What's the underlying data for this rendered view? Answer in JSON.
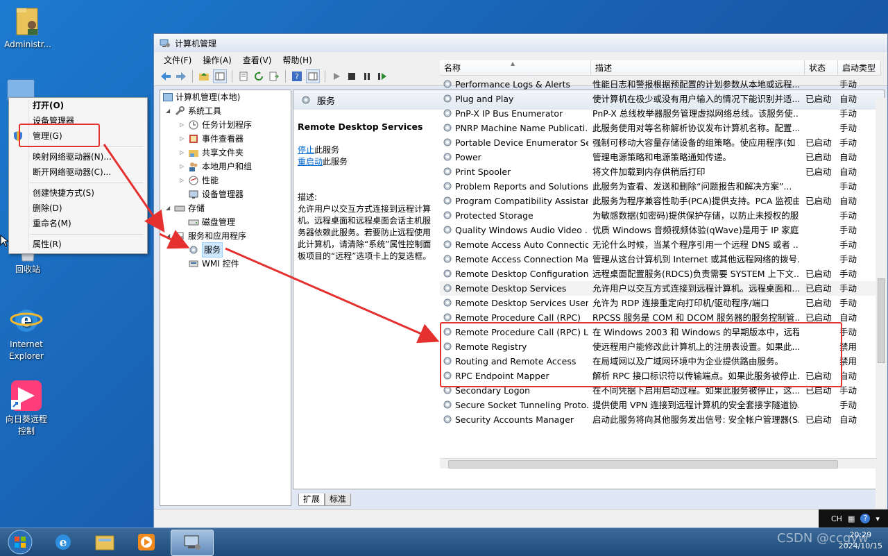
{
  "desktop": {
    "icons": [
      {
        "label": "Administr..."
      },
      {
        "label": "回收站"
      },
      {
        "label": "Internet Explorer"
      },
      {
        "label": "向日葵远程控制"
      }
    ]
  },
  "window": {
    "title": "计算机管理",
    "menu": [
      "文件(F)",
      "操作(A)",
      "查看(V)",
      "帮助(H)"
    ]
  },
  "tree": {
    "root": "计算机管理(本地)",
    "system_tools": "系统工具",
    "task_scheduler": "任务计划程序",
    "event_viewer": "事件查看器",
    "shared_folders": "共享文件夹",
    "local_users": "本地用户和组",
    "performance": "性能",
    "device_manager": "设备管理器",
    "storage": "存储",
    "disk_management": "磁盘管理",
    "services_apps": "服务和应用程序",
    "services": "服务",
    "wmi": "WMI 控件"
  },
  "content": {
    "header": "服务",
    "service_name": "Remote Desktop Services",
    "stop_link": "停止",
    "stop_suffix": "此服务",
    "restart_link": "重启动",
    "restart_suffix": "此服务",
    "desc_label": "描述:",
    "description": "允许用户以交互方式连接到远程计算机。远程桌面和远程桌面会话主机服务器依赖此服务。若要防止远程使用此计算机，请清除“系统”属性控制面板项目的“远程”选项卡上的复选框。"
  },
  "columns": {
    "name": "名称",
    "desc": "描述",
    "status": "状态",
    "startup": "启动类型"
  },
  "services": [
    {
      "name": "Performance Logs & Alerts",
      "desc": "性能日志和警报根据预配置的计划参数从本地或远程...",
      "status": "",
      "startup": "手动"
    },
    {
      "name": "Plug and Play",
      "desc": "使计算机在极少或没有用户输入的情况下能识别并适...",
      "status": "已启动",
      "startup": "自动"
    },
    {
      "name": "PnP-X IP Bus Enumerator",
      "desc": "PnP-X 总线枚举器服务管理虚拟网络总线。该服务使...",
      "status": "",
      "startup": "手动"
    },
    {
      "name": "PNRP Machine Name Publicati...",
      "desc": "此服务使用对等名称解析协议发布计算机名称。配置...",
      "status": "",
      "startup": "手动"
    },
    {
      "name": "Portable Device Enumerator Se...",
      "desc": "强制可移动大容量存储设备的组策略。使应用程序(如 ...",
      "status": "已启动",
      "startup": "手动"
    },
    {
      "name": "Power",
      "desc": "管理电源策略和电源策略通知传递。",
      "status": "已启动",
      "startup": "自动"
    },
    {
      "name": "Print Spooler",
      "desc": "将文件加载到内存供稍后打印",
      "status": "已启动",
      "startup": "自动"
    },
    {
      "name": "Problem Reports and Solutions...",
      "desc": "此服务为查看、发送和删除“问题报告和解决方案”...",
      "status": "",
      "startup": "手动"
    },
    {
      "name": "Program Compatibility Assistan...",
      "desc": "此服务为程序兼容性助手(PCA)提供支持。PCA 监视由...",
      "status": "已启动",
      "startup": "自动"
    },
    {
      "name": "Protected Storage",
      "desc": "为敏感数据(如密码)提供保护存储，以防止未授权的服...",
      "status": "",
      "startup": "手动"
    },
    {
      "name": "Quality Windows Audio Video ...",
      "desc": "优质 Windows 音频视频体验(qWave)是用于 IP 家庭...",
      "status": "",
      "startup": "手动"
    },
    {
      "name": "Remote Access Auto Connectio...",
      "desc": "无论什么时候，当某个程序引用一个远程 DNS 或者 ...",
      "status": "",
      "startup": "手动"
    },
    {
      "name": "Remote Access Connection Ma...",
      "desc": "管理从这台计算机到 Internet 或其他远程网络的拨号...",
      "status": "",
      "startup": "手动"
    },
    {
      "name": "Remote Desktop Configuration",
      "desc": "远程桌面配置服务(RDCS)负责需要 SYSTEM 上下文...",
      "status": "已启动",
      "startup": "手动"
    },
    {
      "name": "Remote Desktop Services",
      "desc": "允许用户以交互方式连接到远程计算机。远程桌面和...",
      "status": "已启动",
      "startup": "手动"
    },
    {
      "name": "Remote Desktop Services User...",
      "desc": "允许为 RDP 连接重定向打印机/驱动程序/端口",
      "status": "已启动",
      "startup": "手动"
    },
    {
      "name": "Remote Procedure Call (RPC)",
      "desc": "RPCSS 服务是 COM 和 DCOM 服务器的服务控制管...",
      "status": "已启动",
      "startup": "自动"
    },
    {
      "name": "Remote Procedure Call (RPC) L...",
      "desc": "在 Windows 2003 和 Windows 的早期版本中，远程...",
      "status": "",
      "startup": "手动"
    },
    {
      "name": "Remote Registry",
      "desc": "使远程用户能修改此计算机上的注册表设置。如果此...",
      "status": "",
      "startup": "禁用"
    },
    {
      "name": "Routing and Remote Access",
      "desc": "在局域网以及广域网环境中为企业提供路由服务。",
      "status": "",
      "startup": "禁用"
    },
    {
      "name": "RPC Endpoint Mapper",
      "desc": "解析 RPC 接口标识符以传输端点。如果此服务被停止...",
      "status": "已启动",
      "startup": "自动"
    },
    {
      "name": "Secondary Logon",
      "desc": "在不同凭据下启用启动过程。如果此服务被停止，这...",
      "status": "已启动",
      "startup": "手动"
    },
    {
      "name": "Secure Socket Tunneling Proto...",
      "desc": "提供使用 VPN 连接到远程计算机的安全套接字隧道协...",
      "status": "",
      "startup": "手动"
    },
    {
      "name": "Security Accounts Manager",
      "desc": "启动此服务将向其他服务发出信号: 安全帐户管理器(S...",
      "status": "已启动",
      "startup": "自动"
    }
  ],
  "tabs": [
    "扩展",
    "标准"
  ],
  "context_menu": {
    "open": "打开(O)",
    "device_manager": "设备管理器",
    "manage": "管理(G)",
    "map_drive": "映射网络驱动器(N)...",
    "disconnect_drive": "断开网络驱动器(C)...",
    "create_shortcut": "创建快捷方式(S)",
    "delete": "删除(D)",
    "rename": "重命名(M)",
    "properties": "属性(R)"
  },
  "tray": {
    "lang": "CH",
    "time": "20:29",
    "date": "2024/10/15"
  },
  "watermark": "CSDN @ccgyw",
  "colors": {
    "annotation_red": "#e53030",
    "selection": "#cde8ff"
  }
}
